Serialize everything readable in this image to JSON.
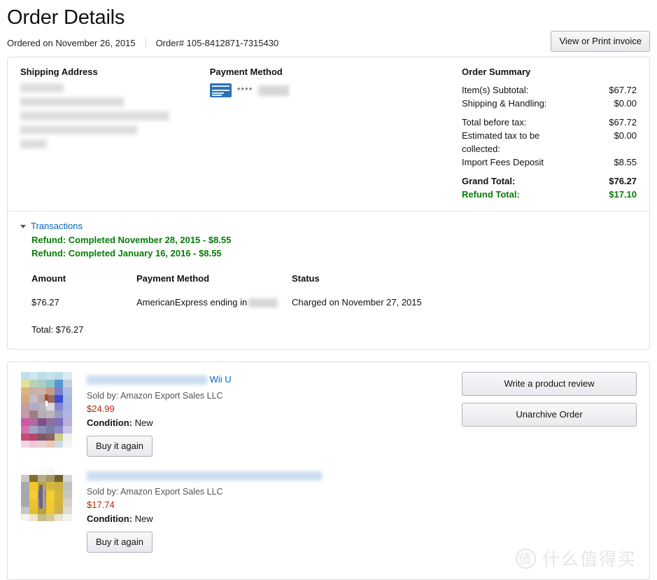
{
  "header": {
    "title": "Order Details",
    "ordered_on": "Ordered on November 26, 2015",
    "order_number": "Order# 105-8412871-7315430",
    "invoice_button": "View or Print invoice"
  },
  "shipping": {
    "heading": "Shipping Address",
    "redacted": true
  },
  "payment": {
    "heading": "Payment Method",
    "card_icon": "americanexpress-card-icon",
    "mask": "****",
    "redacted_digits": true
  },
  "order_summary": {
    "heading": "Order Summary",
    "rows": [
      {
        "label": "Item(s) Subtotal:",
        "value": "$67.72",
        "style": "normal"
      },
      {
        "label": "Shipping & Handling:",
        "value": "$0.00",
        "style": "normal"
      },
      {
        "label": "Total before tax:",
        "value": "$67.72",
        "style": "normal"
      },
      {
        "label": "Estimated tax to be collected:",
        "value": "$0.00",
        "style": "normal"
      },
      {
        "label": "Import Fees Deposit",
        "value": "$8.55",
        "style": "normal"
      },
      {
        "label": "Grand Total:",
        "value": "$76.27",
        "style": "bold"
      },
      {
        "label": "Refund Total:",
        "value": "$17.10",
        "style": "green"
      }
    ]
  },
  "transactions": {
    "toggle_label": "Transactions",
    "refunds": [
      "Refund: Completed November 28, 2015 - $8.55",
      "Refund: Completed January 16, 2016 - $8.55"
    ],
    "columns": [
      "Amount",
      "Payment Method",
      "Status"
    ],
    "rows": [
      {
        "amount": "$76.27",
        "method_prefix": "AmericanExpress ending in",
        "method_redacted": true,
        "status": "Charged on November 27, 2015"
      }
    ],
    "total": "Total: $76.27"
  },
  "items": {
    "side_actions": [
      "Write a product review",
      "Unarchive Order"
    ],
    "list": [
      {
        "title_redacted": true,
        "title_suffix": "Wii U",
        "sold_by": "Sold by: Amazon Export Sales LLC",
        "price": "$24.99",
        "condition_label": "Condition:",
        "condition_value": "New",
        "buy_again": "Buy it again",
        "thumb": "pixelated-colorful-product-image"
      },
      {
        "title_redacted": true,
        "title_suffix": "",
        "sold_by": "Sold by: Amazon Export Sales LLC",
        "price": "$17.74",
        "condition_label": "Condition:",
        "condition_value": "New",
        "buy_again": "Buy it again",
        "thumb": "pixelated-yellow-product-image"
      }
    ]
  },
  "watermark": {
    "badge": "值",
    "text": "什么值得买"
  },
  "colors": {
    "link": "#0066c0",
    "green": "#067d06",
    "price": "#b12704",
    "card_border": "#dddddd",
    "amex_blue": "#2a72b5"
  }
}
